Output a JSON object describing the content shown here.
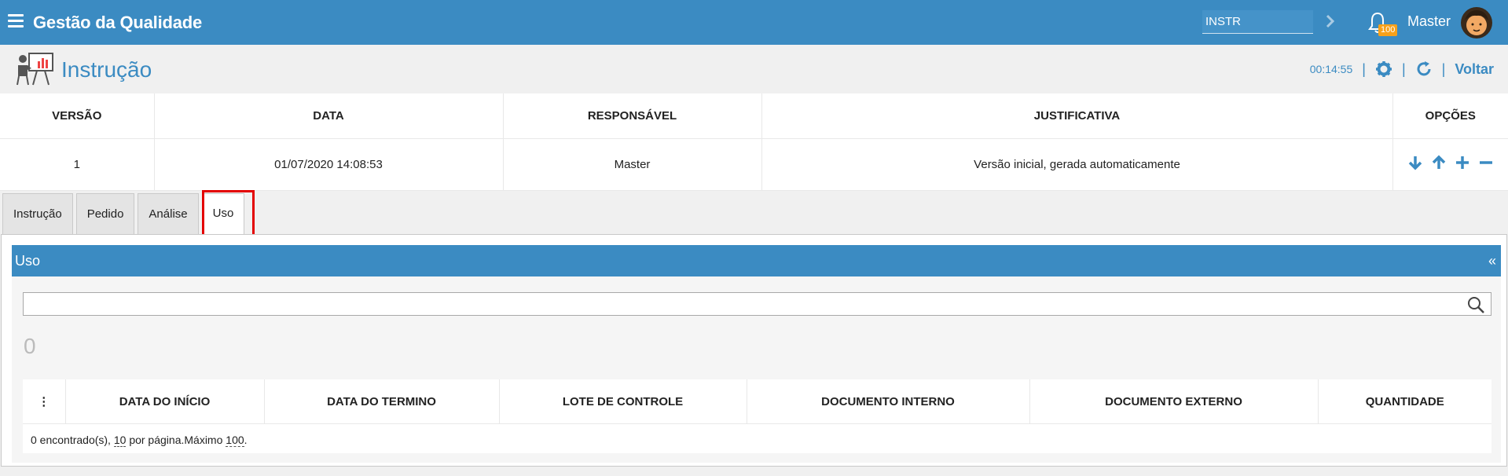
{
  "app": {
    "title": "Gestão da Qualidade",
    "search_value": "INSTR",
    "notification_count": "100",
    "user_name": "Master"
  },
  "page": {
    "title": "Instrução",
    "timer": "00:14:55",
    "back_label": "Voltar"
  },
  "versions": {
    "headers": [
      "VERSÃO",
      "DATA",
      "RESPONSÁVEL",
      "JUSTIFICATIVA",
      "OPÇÕES"
    ],
    "rows": [
      {
        "version": "1",
        "date": "01/07/2020 14:08:53",
        "responsible": "Master",
        "justification": "Versão inicial, gerada automaticamente"
      }
    ]
  },
  "tabs": [
    {
      "label": "Instrução"
    },
    {
      "label": "Pedido"
    },
    {
      "label": "Análise"
    },
    {
      "label": "Uso"
    }
  ],
  "panel": {
    "title": "Uso",
    "collapse_label": "«",
    "count": "0",
    "columns": [
      "DATA DO INÍCIO",
      "DATA DO TERMINO",
      "LOTE DE CONTROLE",
      "DOCUMENTO INTERNO",
      "DOCUMENTO EXTERNO",
      "QUANTIDADE"
    ],
    "footer": {
      "found": "0 encontrado(s),",
      "per_page": "10",
      "per_page_text": "por página.",
      "max_label": "Máximo",
      "max_value": "100",
      "end": "."
    }
  },
  "colors": {
    "primary": "#3b8bc2",
    "highlight": "#e30000",
    "badge": "#f7a11a"
  }
}
